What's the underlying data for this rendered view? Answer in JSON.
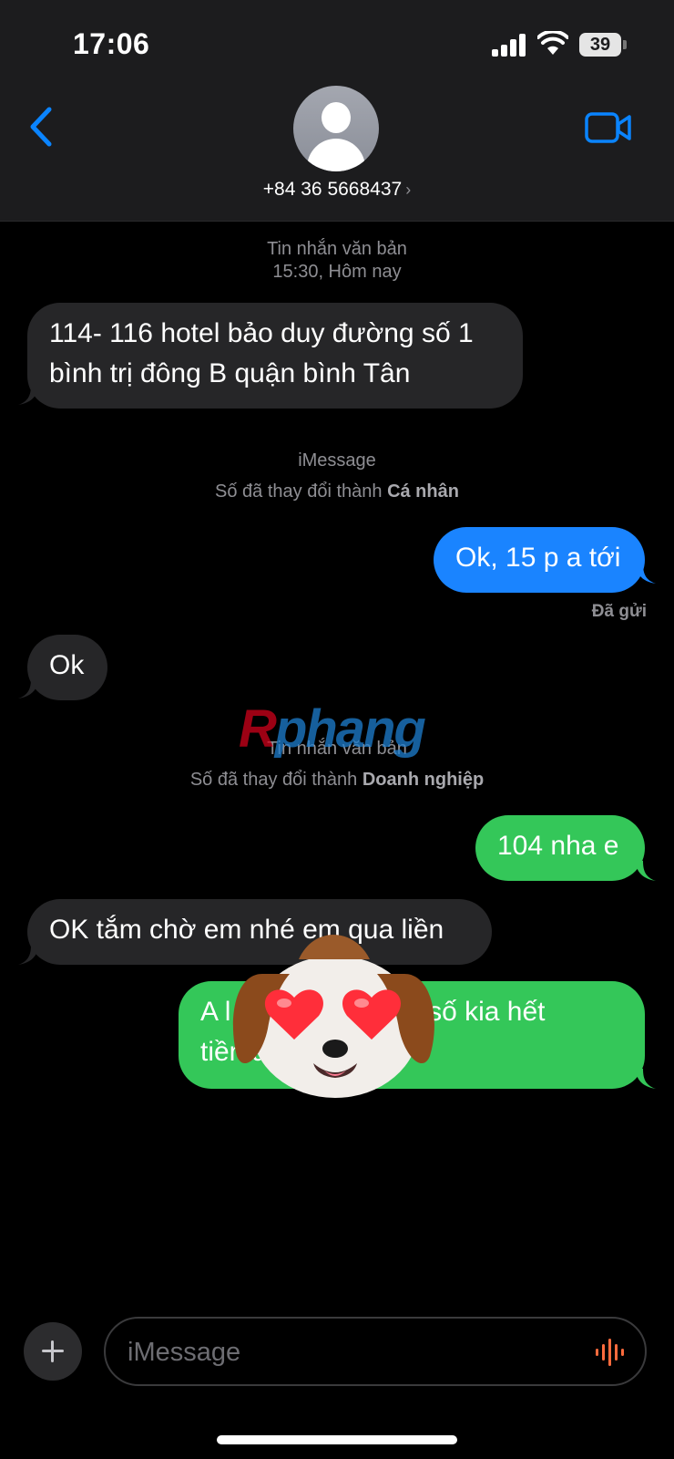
{
  "status_bar": {
    "time": "17:06",
    "battery": "39"
  },
  "header": {
    "contact": "+84 36 5668437",
    "chevron": "›"
  },
  "thread": {
    "meta1": {
      "line1": "Tin nhắn văn bản",
      "line2": "15:30, Hôm nay"
    },
    "msg1": "114- 116 hotel bảo duy đường số 1 bình trị đông B quận bình Tân",
    "meta2": {
      "line1": "iMessage",
      "line2_prefix": "Số đã thay đổi thành ",
      "line2_bold": "Cá nhân"
    },
    "msg2": "Ok, 15 p a tới",
    "delivered": "Đã gửi",
    "msg3": "Ok",
    "meta3": {
      "line1": "Tin nhắn văn bản",
      "line2_prefix": "Số đã thay đổi thành ",
      "line2_bold": "Doanh nghiệp"
    },
    "msg4": "104 nha e",
    "msg5": "OK tắm chờ em nhé em qua liền",
    "msg6_line1a": "A l",
    "msg6_line1b": "nha, số kia hết",
    "msg6_line2": "tiền a"
  },
  "watermark": {
    "r": "R",
    "rest": "phang"
  },
  "composer": {
    "placeholder": "iMessage"
  },
  "colors": {
    "blue": "#1a84ff",
    "green": "#34c759",
    "received": "#262628",
    "accent": "#0a84ff"
  }
}
